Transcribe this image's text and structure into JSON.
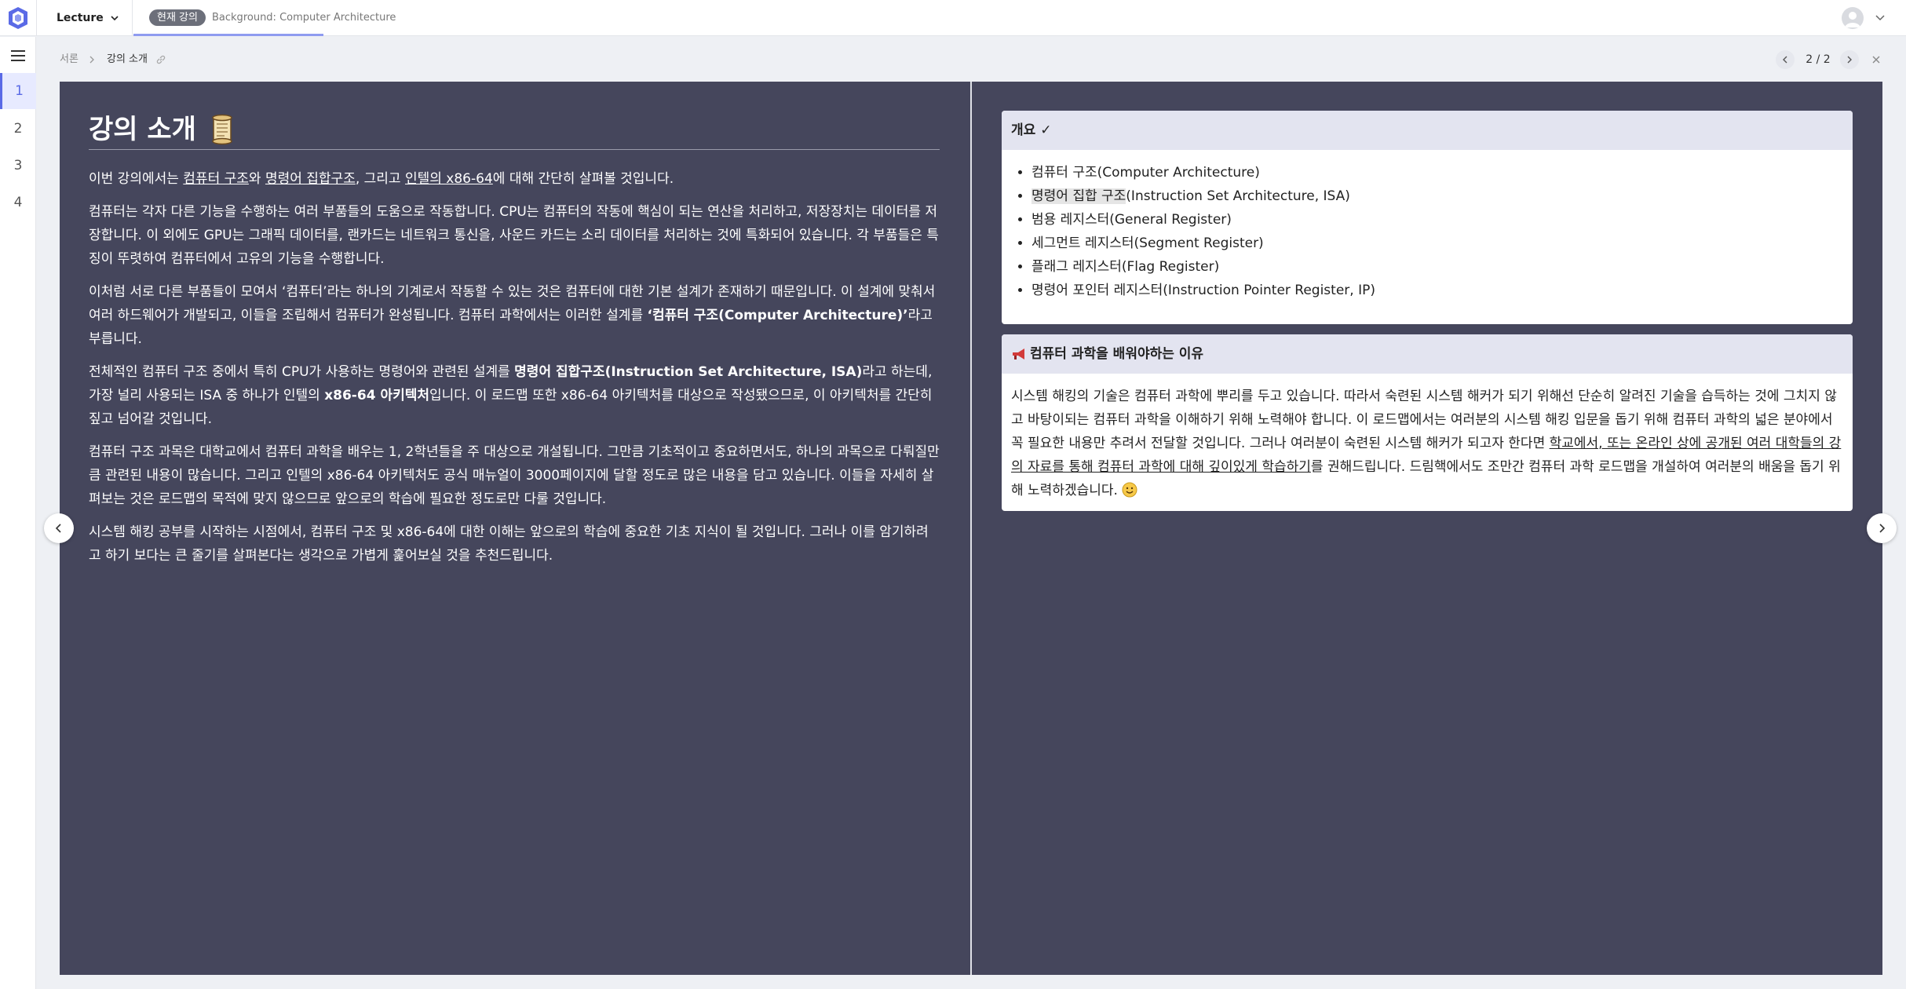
{
  "header": {
    "menu_label": "Lecture",
    "current_badge": "현재 강의",
    "current_title": "Background: Computer Architecture"
  },
  "sidebar": {
    "items": [
      {
        "label": "1",
        "active": true
      },
      {
        "label": "2",
        "active": false
      },
      {
        "label": "3",
        "active": false
      },
      {
        "label": "4",
        "active": false
      }
    ]
  },
  "breadcrumb": {
    "parent": "서론",
    "current": "강의 소개"
  },
  "pager": {
    "text": "2 / 2"
  },
  "slide": {
    "title": "강의 소개",
    "left": {
      "p1": {
        "a": "이번 강의에서는 ",
        "b": "컴퓨터 구조",
        "c": "와 ",
        "d": "명령어 집합구조",
        "e": ", 그리고 ",
        "f": "인텔의 x86-64",
        "g": "에 대해 간단히 살펴볼 것입니다."
      },
      "p2": "컴퓨터는 각자 다른 기능을 수행하는 여러 부품들의 도움으로 작동합니다. CPU는 컴퓨터의 작동에 핵심이 되는 연산을 처리하고, 저장장치는 데이터를 저장합니다. 이 외에도 GPU는 그래픽 데이터를, 랜카드는 네트워크 통신을, 사운드 카드는 소리 데이터를 처리하는 것에 특화되어 있습니다. 각 부품들은 특징이 뚜렷하여 컴퓨터에서 고유의 기능을 수행합니다.",
      "p3": {
        "a": "이처럼 서로 다른 부품들이 모여서 ‘컴퓨터’라는 하나의 기계로서 작동할 수 있는 것은 컴퓨터에 대한 기본 설계가 존재하기 때문입니다. 이 설계에 맞춰서 여러 하드웨어가 개발되고, 이들을 조립해서 컴퓨터가 완성됩니다. 컴퓨터 과학에서는 이러한 설계를 ",
        "b": "‘컴퓨터 구조(Computer Architecture)’",
        "c": "라고 부릅니다."
      },
      "p4": {
        "a": "전체적인 컴퓨터 구조 중에서 특히 CPU가 사용하는 명령어와 관련된 설계를 ",
        "b": "명령어 집합구조(Instruction Set Architecture, ISA)",
        "c": "라고 하는데, 가장 널리 사용되는 ISA 중 하나가 인텔의 ",
        "d": "x86-64 아키텍처",
        "e": "입니다. 이 로드맵 또한 x86-64 아키텍처를 대상으로 작성됐으므로, 이 아키텍처를 간단히 짚고 넘어갈 것입니다."
      },
      "p5": "컴퓨터 구조 과목은 대학교에서 컴퓨터 과학을 배우는 1, 2학년들을 주 대상으로 개설됩니다. 그만큼 기초적이고 중요하면서도, 하나의 과목으로 다뤄질만큼 관련된 내용이 많습니다. 그리고 인텔의 x86-64 아키텍처도 공식 매뉴얼이 3000페이지에 달할 정도로 많은 내용을 담고 있습니다. 이들을 자세히 살펴보는 것은 로드맵의 목적에 맞지 않으므로 앞으로의 학습에 필요한 정도로만 다룰 것입니다.",
      "p6": "시스템 해킹 공부를 시작하는 시점에서, 컴퓨터 구조 및 x86-64에 대한 이해는 앞으로의 학습에 중요한 기초 지식이 될 것입니다. 그러나 이를 암기하려고 하기 보다는 큰 줄기를 살펴본다는 생각으로 가볍게 훑어보실 것을 추천드립니다."
    },
    "overview": {
      "title": "개요 ✓",
      "items": [
        {
          "hl": "",
          "text": "컴퓨터 구조(Computer Architecture)"
        },
        {
          "hl": "명령어 집합 구조",
          "text": "(Instruction Set Architecture, ISA)"
        },
        {
          "hl": "",
          "text": "범용 레지스터(General Register)"
        },
        {
          "hl": "",
          "text": "세그먼트 레지스터(Segment Register)"
        },
        {
          "hl": "",
          "text": "플래그 레지스터(Flag Register)"
        },
        {
          "hl": "",
          "text": "명령어 포인터 레지스터(Instruction Pointer Register, IP)"
        }
      ]
    },
    "why": {
      "title": "컴퓨터 과학을 배워야하는 이유",
      "a": "시스템 해킹의 기술은 컴퓨터 과학에 뿌리를 두고 있습니다. 따라서 숙련된 시스템 해커가 되기 위해선 단순히 알려진 기술을 습득하는 것에 그치지 않고 바탕이되는 컴퓨터 과학을 이해하기 위해 노력해야 합니다. 이 로드맵에서는 여러분의 시스템 해킹 입문을 돕기 위해 컴퓨터 과학의 넓은 분야에서 꼭 필요한 내용만 추려서 전달할 것입니다. 그러나 여러분이 숙련된 시스템 해커가 되고자 한다면 ",
      "b": "학교에서, 또는 온라인 상에 공개된 여러 대학들의 강의 자료를 통해 컴퓨터 과학에 대해 깊이있게 학습하기",
      "c": "를 권해드립니다. 드림핵에서도 조만간 컴퓨터 과학 로드맵을 개설하여 여러분의 배움을 돕기 위해 노력하겠습니다."
    }
  }
}
